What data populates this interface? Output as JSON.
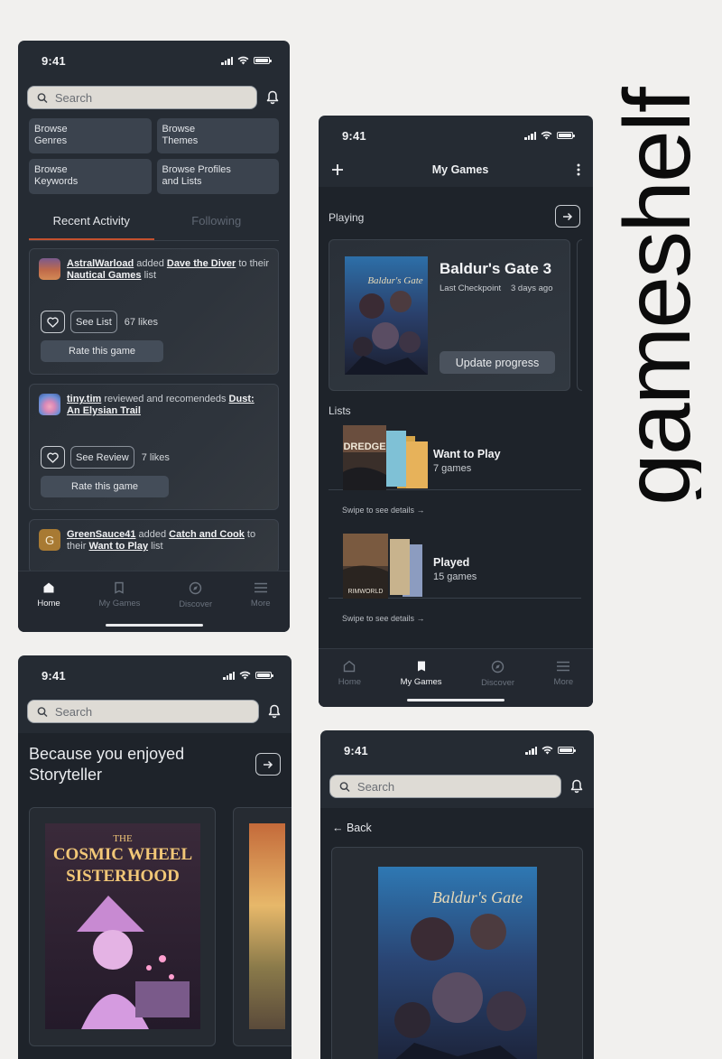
{
  "brand": {
    "wordmark": "gameshelf"
  },
  "status": {
    "time": "9:41"
  },
  "search": {
    "placeholder": "Search"
  },
  "home": {
    "browse": [
      {
        "line1": "Browse",
        "line2": "Genres"
      },
      {
        "line1": "Browse",
        "line2": "Themes"
      },
      {
        "line1": "Browse",
        "line2": "Keywords"
      },
      {
        "line1": "Browse Profiles",
        "line2": "and Lists"
      }
    ],
    "tabs": [
      "Recent Activity",
      "Following"
    ],
    "feed": [
      {
        "user": "AstralWarload",
        "action": " added ",
        "target": "Dave the Diver",
        "mid": " to their ",
        "list": "Nautical Games",
        "end": " list",
        "button": "See List",
        "likes": "67 likes",
        "rate": "Rate this game"
      },
      {
        "user": "tiny.tim",
        "action": " reviewed and recomendeds ",
        "target": "Dust: An Elysian Trail",
        "button": "See Review",
        "likes": "7 likes",
        "rate": "Rate this game"
      },
      {
        "user": "GreenSauce41",
        "avatar_letter": "G",
        "action": " added ",
        "target": "Catch and Cook",
        "mid": " to their ",
        "list": "Want to Play",
        "end": " list"
      }
    ]
  },
  "nav": {
    "items": [
      {
        "label": "Home",
        "icon": "home-icon"
      },
      {
        "label": "My Games",
        "icon": "book-icon"
      },
      {
        "label": "Discover",
        "icon": "compass-icon"
      },
      {
        "label": "More",
        "icon": "menu-icon"
      }
    ]
  },
  "mygames": {
    "title": "My Games",
    "playing_label": "Playing",
    "game": {
      "title": "Baldur's Gate 3",
      "checkpoint_label": "Last Checkpoint",
      "checkpoint_time": "3 days ago",
      "update": "Update progress",
      "cover_text": "Baldur's Gate"
    },
    "lists_label": "Lists",
    "lists": [
      {
        "name": "Want to Play",
        "count": "7 games",
        "cover_text": "DREDGE",
        "swipe": "Swipe to see details →"
      },
      {
        "name": "Played",
        "count": "15 games",
        "cover_text": "RIMWORLD",
        "swipe": "Swipe to see details →"
      }
    ]
  },
  "discover": {
    "heading": "Because you enjoyed Storyteller",
    "cover": {
      "line1": "THE",
      "line2": "COSMIC WHEEL",
      "line3": "SISTERHOOD"
    }
  },
  "detail": {
    "back": "← Back",
    "cover_text": "Baldur's Gate"
  },
  "colors": {
    "background": "#f1f0ee",
    "phone": "#252b33",
    "accent": "#c4512e",
    "search": "#dedbd5"
  }
}
